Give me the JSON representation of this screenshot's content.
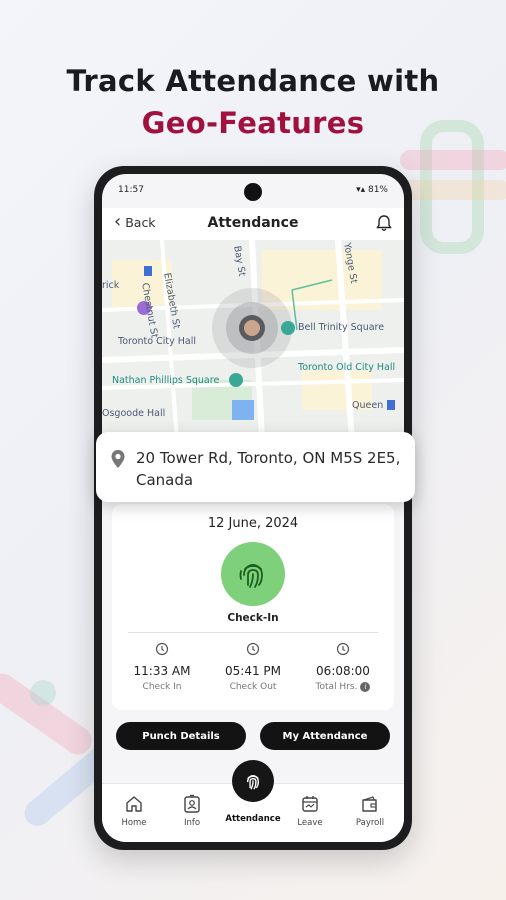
{
  "headline": {
    "line1": "Track Attendance with",
    "line2": "Geo-Features"
  },
  "colors": {
    "accent": "#a0123d",
    "checkin_green": "#7ed07a",
    "button_dark": "#131313"
  },
  "status_bar": {
    "time": "11:57",
    "battery": "81%"
  },
  "app_bar": {
    "back_label": "Back",
    "title": "Attendance",
    "back_icon": "chevron-left-icon",
    "notification_icon": "bell-icon"
  },
  "map": {
    "labels": [
      "Elizabeth St",
      "Chestnut St",
      "Bay St",
      "Yonge St",
      "Toronto City Hall",
      "Bell Trinity Square",
      "Nathan Phillips Square",
      "Toronto Old City Hall",
      "Queen",
      "Osgoode Hall",
      "rick"
    ]
  },
  "location": {
    "address": "20 Tower Rd, Toronto, ON M5S 2E5, Canada",
    "icon": "location-pin-icon"
  },
  "attendance": {
    "date": "12 June, 2024",
    "check_in_label": "Check-In",
    "stats": [
      {
        "value": "11:33 AM",
        "caption": "Check In"
      },
      {
        "value": "05:41 PM",
        "caption": "Check Out"
      },
      {
        "value": "06:08:00",
        "caption": "Total Hrs."
      }
    ]
  },
  "buttons": {
    "punch_details": "Punch Details",
    "my_attendance": "My Attendance"
  },
  "bottom_nav": {
    "items": [
      {
        "label": "Home",
        "icon": "home-icon"
      },
      {
        "label": "Info",
        "icon": "id-card-icon"
      },
      {
        "label": "Attendance",
        "icon": "fingerprint-icon"
      },
      {
        "label": "Leave",
        "icon": "calendar-icon"
      },
      {
        "label": "Payroll",
        "icon": "wallet-icon"
      }
    ]
  }
}
